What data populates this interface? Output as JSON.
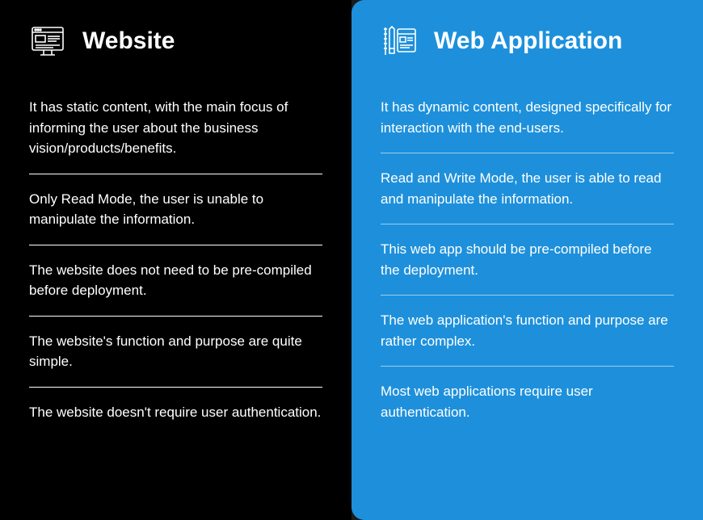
{
  "left": {
    "title": "Website",
    "items": [
      "It has static content, with the main focus of informing the user about the business vision/products/benefits.",
      "Only Read Mode, the user is unable to manipulate the information.",
      "The website does not need to be pre-compiled before deployment.",
      "The website's function and purpose are quite simple.",
      "The website doesn't require user authentication."
    ]
  },
  "right": {
    "title": "Web Application",
    "items": [
      "It has dynamic content, designed specifically for interaction with the end-users.",
      "Read and Write Mode, the user is able to read and manipulate the information.",
      "This web app should be pre-compiled before the deployment.",
      "The web application's function and purpose are rather complex.",
      "Most web applications require user authentication."
    ]
  }
}
